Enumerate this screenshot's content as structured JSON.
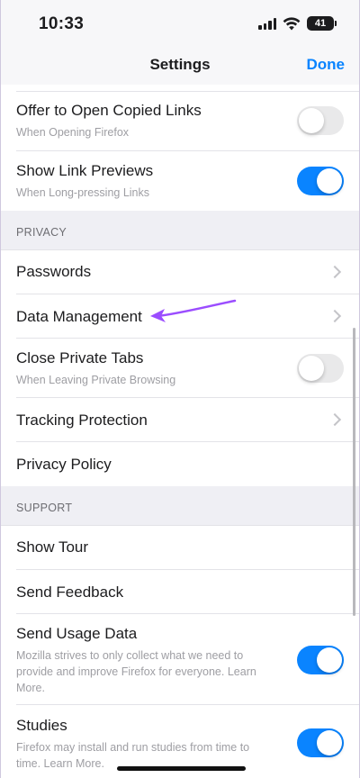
{
  "status": {
    "time": "10:33",
    "battery": "41"
  },
  "nav": {
    "title": "Settings",
    "done": "Done"
  },
  "rows_top": [
    {
      "title": "Offer to Open Copied Links",
      "subtitle": "When Opening Firefox",
      "toggle": false
    },
    {
      "title": "Show Link Previews",
      "subtitle": "When Long-pressing Links",
      "toggle": true
    }
  ],
  "privacy": {
    "header": "PRIVACY",
    "items": [
      {
        "title": "Passwords"
      },
      {
        "title": "Data Management"
      },
      {
        "title": "Close Private Tabs",
        "subtitle": "When Leaving Private Browsing",
        "toggle": false
      },
      {
        "title": "Tracking Protection"
      },
      {
        "title": "Privacy Policy"
      }
    ]
  },
  "support": {
    "header": "SUPPORT",
    "items": [
      {
        "title": "Show Tour"
      },
      {
        "title": "Send Feedback"
      },
      {
        "title": "Send Usage Data",
        "subtitle_lines": [
          "Mozilla strives to only collect what we need to",
          "provide and improve Firefox for everyone. Learn",
          "More."
        ],
        "toggle": true
      },
      {
        "title": "Studies",
        "subtitle_lines": [
          "Firefox may install and run studies from time to",
          "time. Learn More."
        ],
        "toggle": true
      }
    ]
  },
  "colors": {
    "accent": "#0a84ff",
    "annotation_arrow": "#9b4dff"
  },
  "icons": {
    "chevron": "chevron-right-icon",
    "signal": "cellular-signal-icon",
    "wifi": "wifi-icon",
    "battery": "battery-icon"
  }
}
